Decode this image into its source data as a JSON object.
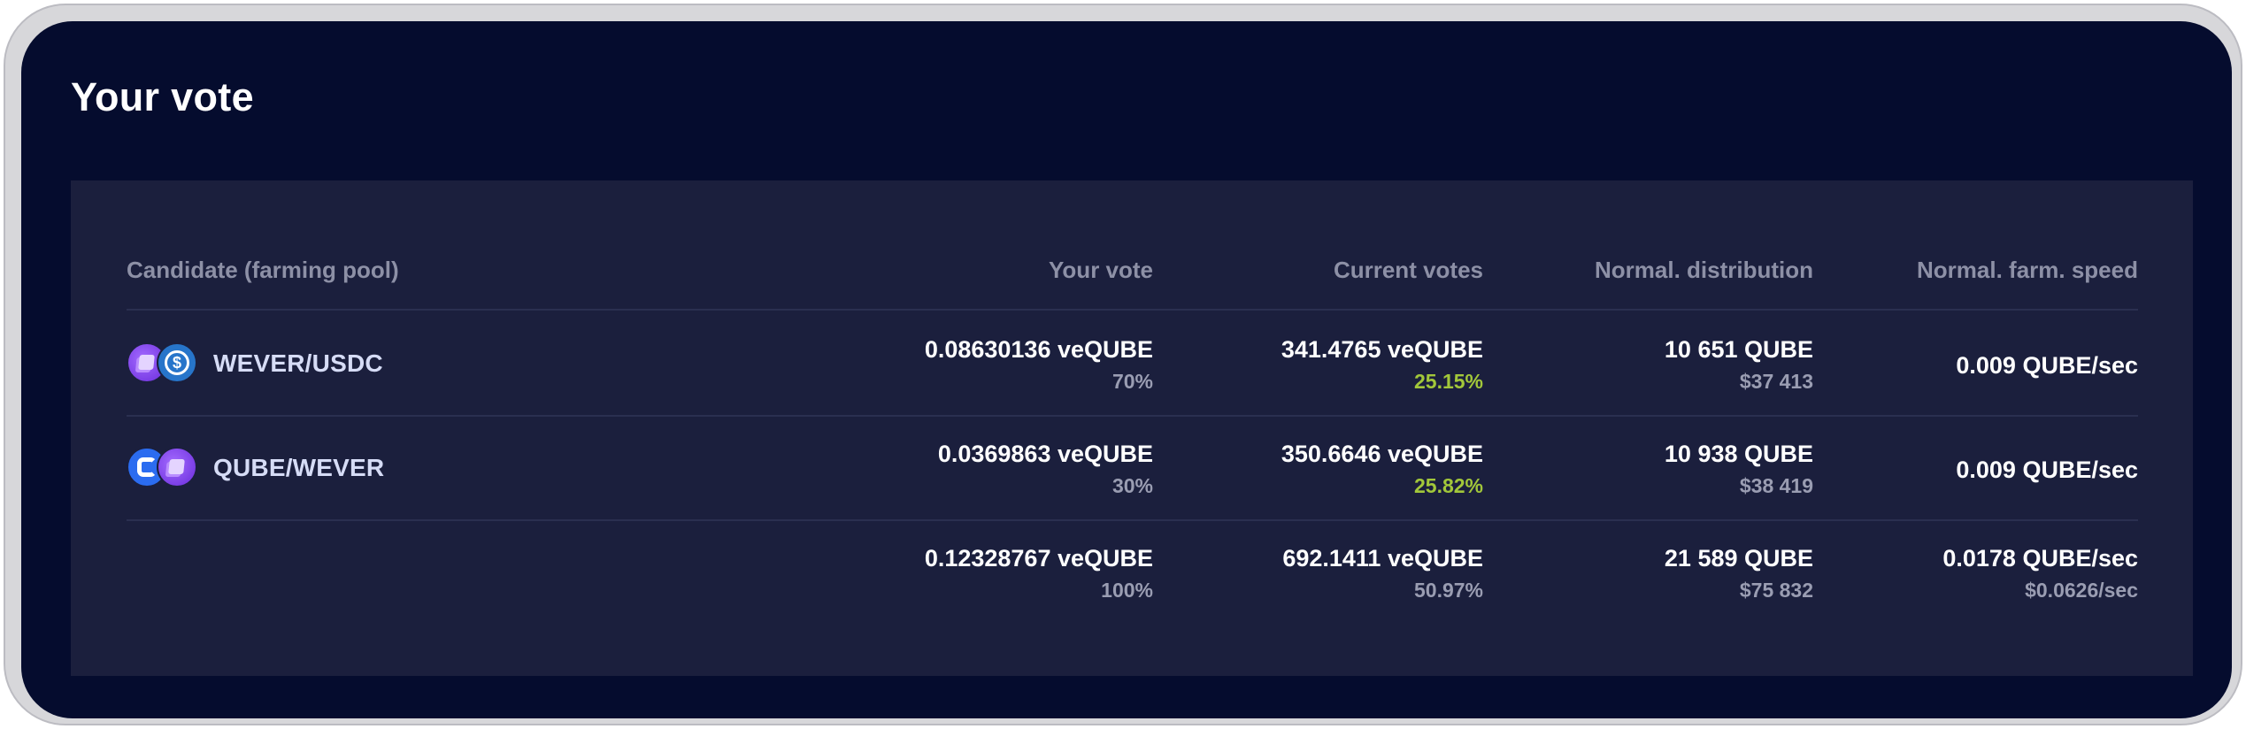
{
  "card": {
    "title": "Your vote"
  },
  "table": {
    "headers": {
      "candidate": "Candidate (farming pool)",
      "your_vote": "Your vote",
      "current_votes": "Current votes",
      "normal_distribution": "Normal. distribution",
      "normal_farm_speed": "Normal. farm. speed"
    },
    "rows": [
      {
        "pool": "WEVER/USDC",
        "icons": [
          "wever-token-icon",
          "usdc-token-icon"
        ],
        "your_vote": "0.08630136 veQUBE",
        "your_vote_pct": "70%",
        "current_votes": "341.4765 veQUBE",
        "current_votes_pct": "25.15%",
        "distribution": "10 651 QUBE",
        "distribution_usd": "$37 413",
        "farm_speed": "0.009 QUBE/sec"
      },
      {
        "pool": "QUBE/WEVER",
        "icons": [
          "qube-token-icon",
          "wever-token-icon"
        ],
        "your_vote": "0.0369863 veQUBE",
        "your_vote_pct": "30%",
        "current_votes": "350.6646 veQUBE",
        "current_votes_pct": "25.82%",
        "distribution": "10 938 QUBE",
        "distribution_usd": "$38 419",
        "farm_speed": "0.009 QUBE/sec"
      }
    ],
    "total": {
      "your_vote": "0.12328767 veQUBE",
      "your_vote_pct": "100%",
      "current_votes": "692.1411 veQUBE",
      "current_votes_pct": "50.97%",
      "distribution": "21 589 QUBE",
      "distribution_usd": "$75 832",
      "farm_speed": "0.0178 QUBE/sec",
      "farm_speed_usd": "$0.0626/sec"
    }
  },
  "colors": {
    "background": "#050c2e",
    "panel": "#1b1f3d",
    "positive_share": "#a2c73a",
    "header_text": "#8d90a6"
  }
}
